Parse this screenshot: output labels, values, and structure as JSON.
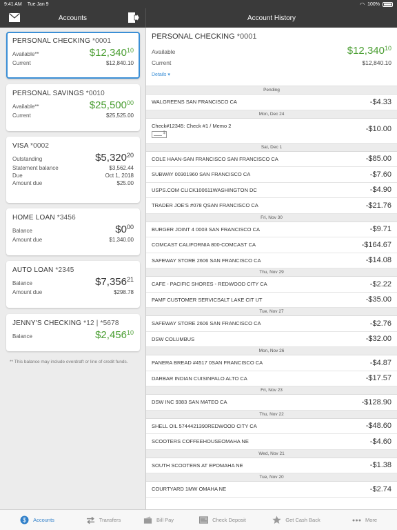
{
  "statusbar": {
    "time": "9:41 AM",
    "date": "Tue Jan 9",
    "battery": "100%"
  },
  "nav": {
    "left_title": "Accounts",
    "right_title": "Account History"
  },
  "accounts": [
    {
      "name": "PERSONAL CHECKING",
      "num": "*0001",
      "rows": [
        {
          "label": "Available**",
          "big_main": "$12,340",
          "big_cents": "10",
          "green": true
        },
        {
          "label": "Current",
          "value": "$12,840.10"
        }
      ]
    },
    {
      "name": "PERSONAL SAVINGS",
      "num": "*0010",
      "rows": [
        {
          "label": "Available**",
          "big_main": "$25,500",
          "big_cents": "00",
          "green": true
        },
        {
          "label": "Current",
          "value": "$25,525.00"
        }
      ]
    },
    {
      "name": "VISA",
      "num": "*0002",
      "rows": [
        {
          "label": "Outstanding",
          "big_main": "$5,320",
          "big_cents": "20",
          "green": false
        },
        {
          "label": "Statement balance",
          "value": "$3,562.44"
        },
        {
          "label": "Due",
          "value": "Oct 1, 2018"
        },
        {
          "label": "Amount due",
          "value": "$25.00"
        }
      ]
    },
    {
      "name": "HOME LOAN",
      "num": "*3456",
      "rows": [
        {
          "label": "Balance",
          "big_main": "$0",
          "big_cents": "00",
          "green": false
        },
        {
          "label": "Amount due",
          "value": "$1,340.00"
        }
      ]
    },
    {
      "name": "AUTO LOAN",
      "num": "*2345",
      "rows": [
        {
          "label": "Balance",
          "big_main": "$7,356",
          "big_cents": "21",
          "green": false
        },
        {
          "label": "Amount due",
          "value": "$298.78"
        }
      ]
    },
    {
      "name": "JENNY'S CHECKING",
      "num": "*12 | *5678",
      "rows": [
        {
          "label": "Balance",
          "big_main": "$2,456",
          "big_cents": "10",
          "green": true
        }
      ]
    }
  ],
  "footnote": "** This balance may include overdraft or line of credit funds.",
  "detail": {
    "name": "PERSONAL CHECKING",
    "num": "*0001",
    "available_label": "Available",
    "available_main": "$12,340",
    "available_cents": "10",
    "current_label": "Current",
    "current_value": "$12,840.10",
    "details_link": "Details ▾"
  },
  "transactions": [
    {
      "header": "Pending"
    },
    {
      "desc": "WALGREENS SAN FRANCISCO CA",
      "amount": "-$4.33"
    },
    {
      "header": "Mon, Dec 24"
    },
    {
      "desc": "Check#12345: Check #1 / Memo 2",
      "amount": "-$10.00",
      "check": true
    },
    {
      "header": "Sat, Dec 1"
    },
    {
      "desc": "COLE HAAN-SAN FRANCISCO SAN FRANCISCO CA",
      "amount": "-$85.00"
    },
    {
      "desc": "SUBWAY 00301960 SAN FRANCISCO CA",
      "amount": "-$7.60"
    },
    {
      "desc": "USPS.COM CLICK100611WASHINGTON DC",
      "amount": "-$4.90"
    },
    {
      "desc": "TRADER JOE'S #078 QSAN FRANCISCO CA",
      "amount": "-$21.76"
    },
    {
      "header": "Fri, Nov 30"
    },
    {
      "desc": "BURGER JOINT 4 0003 SAN FRANCISCO CA",
      "amount": "-$9.71"
    },
    {
      "desc": "COMCAST CALIFORNIA 800-COMCAST CA",
      "amount": "-$164.67"
    },
    {
      "desc": "SAFEWAY STORE 2606 SAN FRANCISCO CA",
      "amount": "-$14.08"
    },
    {
      "header": "Thu, Nov 29"
    },
    {
      "desc": "CAFE - PACIFIC SHORES - REDWOOD CITY CA",
      "amount": "-$2.22"
    },
    {
      "desc": "PAMF CUSTOMER SERVICSALT LAKE CIT UT",
      "amount": "-$35.00"
    },
    {
      "header": "Tue, Nov 27"
    },
    {
      "desc": "SAFEWAY STORE 2606 SAN FRANCISCO CA",
      "amount": "-$2.76"
    },
    {
      "desc": "DSW COLUMBUS",
      "amount": "-$32.00"
    },
    {
      "header": "Mon, Nov 26"
    },
    {
      "desc": "PANERA BREAD #4517 0SAN FRANCISCO CA",
      "amount": "-$4.87"
    },
    {
      "desc": "DARBAR INDIAN CUISINPALO ALTO CA",
      "amount": "-$17.57"
    },
    {
      "header": "Fri, Nov 23"
    },
    {
      "desc": "DSW INC 9383 SAN MATEO CA",
      "amount": "-$128.90"
    },
    {
      "header": "Thu, Nov 22"
    },
    {
      "desc": "SHELL OIL 5744421390REDWOOD CITY CA",
      "amount": "-$48.60"
    },
    {
      "desc": "SCOOTERS COFFEEHOUSEOMAHA NE",
      "amount": "-$4.60"
    },
    {
      "header": "Wed, Nov 21"
    },
    {
      "desc": "SOUTH SCOOTERS AT EPOMAHA NE",
      "amount": "-$1.38"
    },
    {
      "header": "Tue, Nov 20"
    },
    {
      "desc": "COURTYARD 1MW OMAHA NE",
      "amount": "-$2.74"
    }
  ],
  "tabs": [
    {
      "label": "Accounts",
      "icon": "dollar-circle-icon",
      "active": true
    },
    {
      "label": "Transfers",
      "icon": "transfer-arrows-icon",
      "active": false
    },
    {
      "label": "Bill Pay",
      "icon": "bill-pay-icon",
      "active": false
    },
    {
      "label": "Check Deposit",
      "icon": "check-deposit-icon",
      "active": false
    },
    {
      "label": "Get Cash Back",
      "icon": "star-icon",
      "active": false
    },
    {
      "label": "More",
      "icon": "more-dots-icon",
      "active": false
    }
  ],
  "colors": {
    "green": "#4a9e32",
    "accent": "#3b8fd6",
    "navbar": "#3a3a3a"
  }
}
